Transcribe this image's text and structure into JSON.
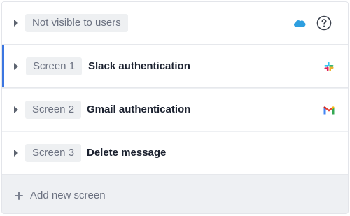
{
  "sections": [
    {
      "badge": "Not visible to users",
      "title": "",
      "icons": [
        "salesforce-icon",
        "help-icon"
      ],
      "active": false
    },
    {
      "badge": "Screen 1",
      "title": "Slack authentication",
      "icons": [
        "slack-icon"
      ],
      "active": true
    },
    {
      "badge": "Screen 2",
      "title": "Gmail authentication",
      "icons": [
        "gmail-icon"
      ],
      "active": false
    },
    {
      "badge": "Screen 3",
      "title": "Delete message",
      "icons": [],
      "active": false
    }
  ],
  "add_screen_label": "Add new screen",
  "colors": {
    "active_indicator": "#3b76e1",
    "badge_bg": "#eef0f2",
    "title_text": "#1c2230",
    "muted_text": "#6b7180",
    "footer_bg": "#eef0f3"
  }
}
